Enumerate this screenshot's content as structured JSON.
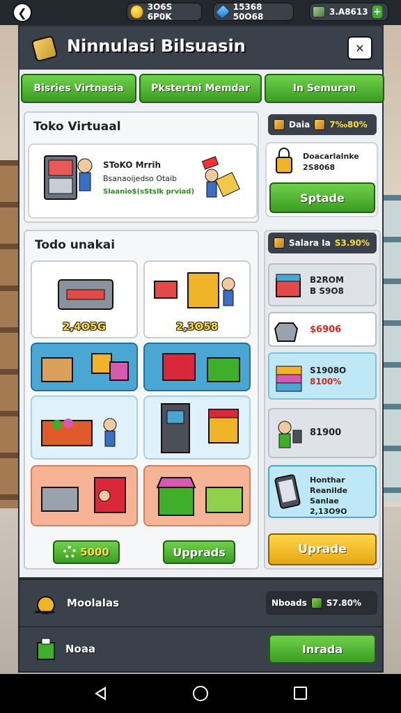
{
  "topbar": {
    "coins": "3O6S 6P0K",
    "gems": "15368 50O68",
    "cash": "3.A8613"
  },
  "header": {
    "title": "Ninnulasi Bilsuasin"
  },
  "tabs": [
    "Bisries Virtnasia",
    "Pkstertni Memdar",
    "In Semuran"
  ],
  "store": {
    "title": "Toko Virtuaal",
    "card_title": "SToKO Mrrih",
    "card_line": "Bsanaoijedso Otaib",
    "card_value": "Slaanio$(sStslk prviad)"
  },
  "side_top": {
    "pill_label": "Daia",
    "pill_value": "7‰80%",
    "card_line1": "Doacarlalnke",
    "card_line2": "2S8068",
    "button": "Sptade"
  },
  "todo": {
    "title": "Todo unakai",
    "cells": [
      {
        "value": "2,4O5G"
      },
      {
        "value": "2,3O58"
      },
      {
        "value": ""
      },
      {
        "value": ""
      },
      {
        "value": ""
      },
      {
        "value": ""
      },
      {
        "value": ""
      },
      {
        "value": ""
      }
    ],
    "cost": "5000",
    "upgrade_button": "Upprads"
  },
  "side_mid": {
    "pill_label": "Salara Ia",
    "pill_value": "S3.90%",
    "items": [
      {
        "line1": "B2ROM",
        "line2": "B S9O8"
      },
      {
        "line1": "$6906",
        "line2": ""
      },
      {
        "line1": "S1908O",
        "line2": "8100%"
      },
      {
        "line1": "81900",
        "line2": ""
      },
      {
        "line1": "Honthar",
        "line2": "Reanilde Sanlae",
        "line3": "2,13O9O"
      }
    ],
    "button": "Uprade"
  },
  "bottom": {
    "row1_label": "Moolalas",
    "row1_pill_label": "Nboads",
    "row1_pill_value": "S7.80%",
    "row2_label": "Noaa",
    "row2_button": "Inrada"
  },
  "colors": {
    "panel_dark": "#3b414b",
    "green": "#3a9d23",
    "yellow": "#e6a712",
    "coin_value": "#ffdc3a",
    "red_value": "#d8281f"
  },
  "icons": [
    "back-icon",
    "coin-icon",
    "gem-icon",
    "cash-icon",
    "plus-icon",
    "hammer-icon",
    "close-icon",
    "gear-icon"
  ]
}
